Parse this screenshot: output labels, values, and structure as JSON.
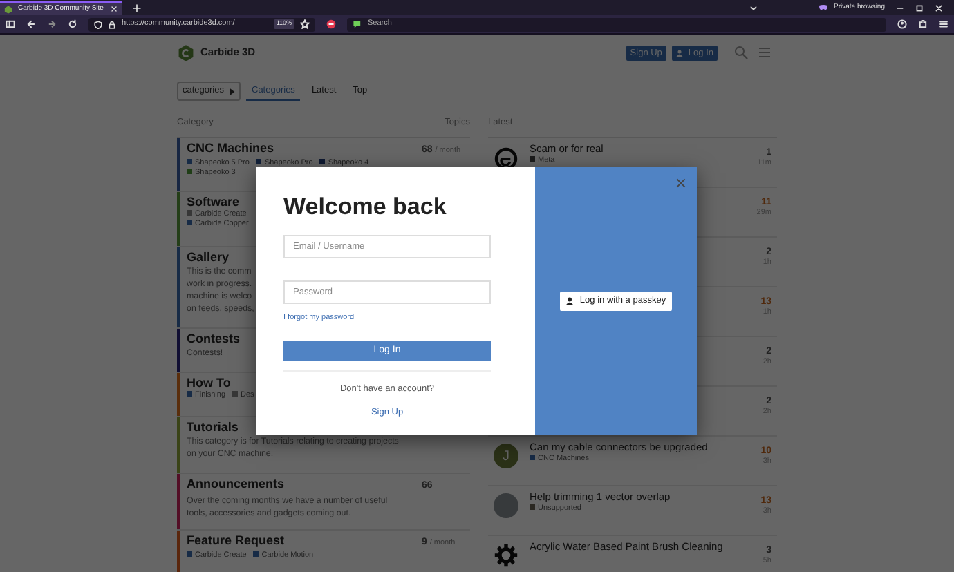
{
  "browser": {
    "tabs": [
      {
        "title": "Carbide 3D Community Site",
        "selected": true
      }
    ],
    "private_label": "Private browsing",
    "url": "https://community.carbide3d.com/",
    "zoom": "110%",
    "search_placeholder": "Search"
  },
  "header": {
    "logo_text": "Carbide 3D",
    "signup": "Sign Up",
    "login": "Log In"
  },
  "nav": {
    "dropdown": "categories",
    "tabs": [
      {
        "label": "Categories",
        "selected": true
      },
      {
        "label": "Latest",
        "selected": false
      },
      {
        "label": "Top",
        "selected": false
      }
    ]
  },
  "categories": {
    "columns": [
      "Category",
      "Topics"
    ],
    "rows": [
      {
        "name": "CNC Machines",
        "color": "#172642",
        "count": "68",
        "period": "/ month",
        "tags": [
          {
            "name": "Shapeoko 5 Pro",
            "color": "#172b46"
          },
          {
            "name": "Shapeoko Pro",
            "color": "#112039"
          },
          {
            "name": "Shapeoko 4",
            "color": "#0e1931"
          },
          {
            "name": "Shapeoko 3",
            "color": "#203e17"
          }
        ]
      },
      {
        "name": "Software",
        "color": "#243e18",
        "tags": [
          {
            "name": "Carbide Create",
            "color": "#373737"
          },
          {
            "name": "Carbide Copper",
            "color": "#172b46"
          }
        ]
      },
      {
        "name": "Gallery",
        "color": "#172b46",
        "description_lines": [
          "This is the comm",
          "work in progress.",
          "machine is welco",
          "on feeds, speeds,"
        ]
      },
      {
        "name": "Contests",
        "color": "#110f33",
        "description_lines": [
          "Contests!"
        ]
      },
      {
        "name": "How To",
        "color": "#5a2e0c",
        "tags": [
          {
            "name": "Finishing",
            "color": "#172b46"
          },
          {
            "name": "Des",
            "color": "#373737"
          }
        ]
      },
      {
        "name": "Tutorials",
        "color": "#3a4317",
        "description_lines": [
          "This category is for Tutorials relating to creating projects",
          "on your CNC machine."
        ]
      },
      {
        "name": "Announcements",
        "color": "#530e26",
        "count": "66",
        "description_lines": [
          "Over the coming months we have a number of useful",
          "tools, accessories and gadgets coming out."
        ]
      },
      {
        "name": "Feature Request",
        "color": "#5a260c",
        "count": "9",
        "period": "/ month",
        "tags": [
          {
            "name": "Carbide Create",
            "color": "#172b46"
          },
          {
            "name": "Carbide Motion",
            "color": "#172b46"
          }
        ]
      }
    ]
  },
  "latest": {
    "heading": "Latest",
    "topics": [
      {
        "title": "Scam or for real",
        "tag": {
          "name": "Meta",
          "color": "#1b1b1b"
        },
        "posts": "1",
        "age": "11m",
        "hot": false,
        "avatar": {
          "kind": "logo"
        }
      },
      {
        "posts": "11",
        "age": "29m",
        "hot": true
      },
      {
        "posts": "2",
        "age": "1h",
        "hot": false
      },
      {
        "posts": "13",
        "age": "1h",
        "hot": true
      },
      {
        "posts": "2",
        "age": "2h",
        "hot": false
      },
      {
        "posts": "2",
        "age": "2h",
        "hot": false
      },
      {
        "title": "Can my cable connectors be upgraded",
        "tag": {
          "name": "CNC Machines",
          "color": "#172b46"
        },
        "posts": "10",
        "age": "3h",
        "hot": true,
        "avatar": {
          "kind": "letter",
          "letter": "J"
        }
      },
      {
        "title": "Help trimming 1 vector overlap",
        "tag": {
          "name": "Unsupported",
          "color": "#2b2822"
        },
        "posts": "13",
        "age": "3h",
        "hot": true,
        "avatar": {
          "kind": "photo"
        }
      },
      {
        "title": "Acrylic Water Based Paint Brush Cleaning",
        "posts": "3",
        "age": "5h",
        "hot": false,
        "avatar": {
          "kind": "gear"
        }
      }
    ]
  },
  "modal": {
    "title": "Welcome back",
    "email_placeholder": "Email / Username",
    "password_placeholder": "Password",
    "forgot": "I forgot my password",
    "login_button": "Log In",
    "no_account": "Don't have an account?",
    "signup": "Sign Up",
    "passkey_button": "Log in with a passkey"
  }
}
